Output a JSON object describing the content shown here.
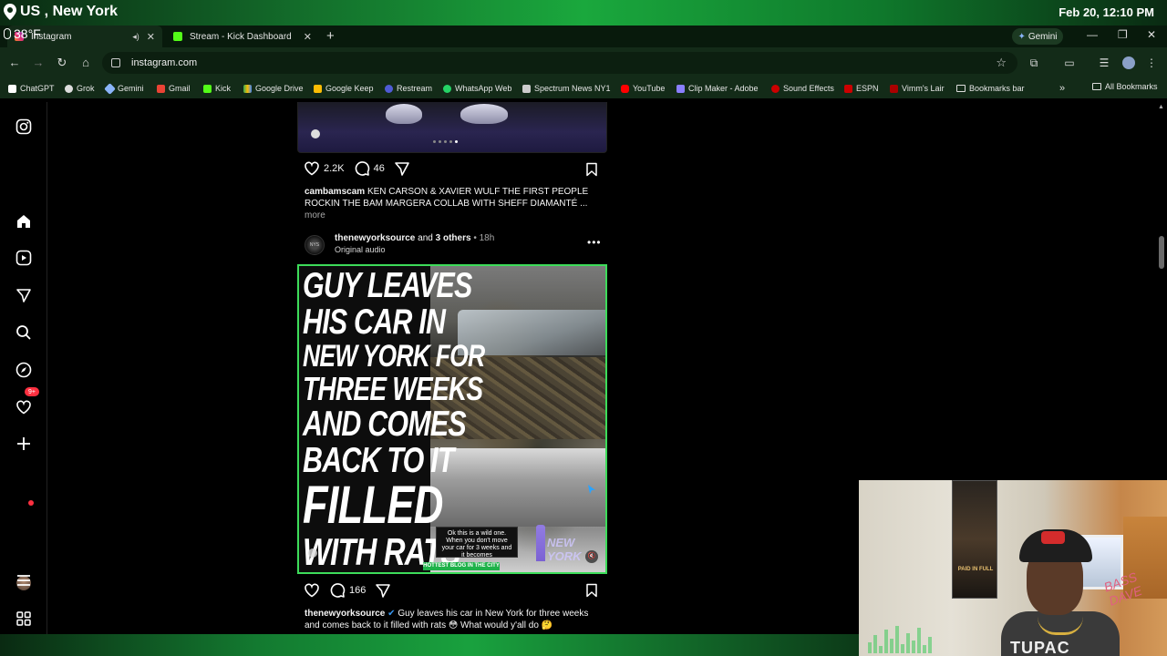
{
  "overlay": {
    "location": "US , New York",
    "datetime": "Feb 20, 12:10 PM",
    "temperature": "38°F"
  },
  "tabs": [
    {
      "title": "Instagram",
      "active": true
    },
    {
      "title": "Stream - Kick Dashboard",
      "active": false
    }
  ],
  "toolbar": {
    "url": "instagram.com",
    "gemini_label": "Gemini"
  },
  "bookmarks": [
    {
      "label": "ChatGPT",
      "color": "#ffffff"
    },
    {
      "label": "Grok",
      "color": "#dddddd"
    },
    {
      "label": "Gemini",
      "color": "#8ab4f8"
    },
    {
      "label": "Gmail",
      "color": "#ea4335"
    },
    {
      "label": "Kick",
      "color": "#53fc18"
    },
    {
      "label": "Google Drive",
      "color": "#fbbc04"
    },
    {
      "label": "Google Keep",
      "color": "#fbbc04"
    },
    {
      "label": "Restream",
      "color": "#4f5bd5"
    },
    {
      "label": "WhatsApp Web",
      "color": "#25d366"
    },
    {
      "label": "Spectrum News NY1",
      "color": "#cccccc"
    },
    {
      "label": "YouTube",
      "color": "#ff0000"
    },
    {
      "label": "Clip Maker - Adobe",
      "color": "#8a7fff"
    },
    {
      "label": "Sound Effects",
      "color": "#cc0000"
    },
    {
      "label": "ESPN",
      "color": "#cc0000"
    },
    {
      "label": "Vimm's Lair",
      "color": "#aa0000"
    },
    {
      "label": "Bookmarks bar",
      "color": "#dddddd"
    }
  ],
  "bookmarks_all": "All Bookmarks",
  "sidebar": {
    "notifications_badge": "9+"
  },
  "post1": {
    "likes": "2.2K",
    "comments": "46",
    "username": "cambamscam",
    "caption": "KEN CARSON & XAVIER WULF THE FIRST PEOPLE ROCKIN THE BAM MARGERA COLLAB WITH SHEFF DIAMANTÉ ...",
    "more": "more"
  },
  "post2": {
    "username": "thenewyorksource",
    "and": "and",
    "others": "3 others",
    "time": "• 18h",
    "audio": "Original audio",
    "avatar_text": "NYS",
    "headline": [
      "GUY LEAVES",
      "HIS CAR IN",
      "NEW YORK FOR",
      "THREE WEEKS",
      "AND COMES",
      "BACK TO IT",
      "FILLED",
      "WITH RATS"
    ],
    "overlay_caption": "Ok this is a wild one. When you don't move your car for 3 weeks and it becomes",
    "watermark": "NEW YORK",
    "tag": "HOTTEST BLOG IN THE CITY",
    "comments": "166",
    "caption_user": "thenewyorksource",
    "caption": "Guy leaves his car in New York for three weeks and comes back to it filled with rats 😳 What would y'all do 🤔"
  },
  "webcam": {
    "poster_text": "PAID IN FULL",
    "shirt_text": "TUPAC",
    "graffiti": "BASS DAVE"
  }
}
